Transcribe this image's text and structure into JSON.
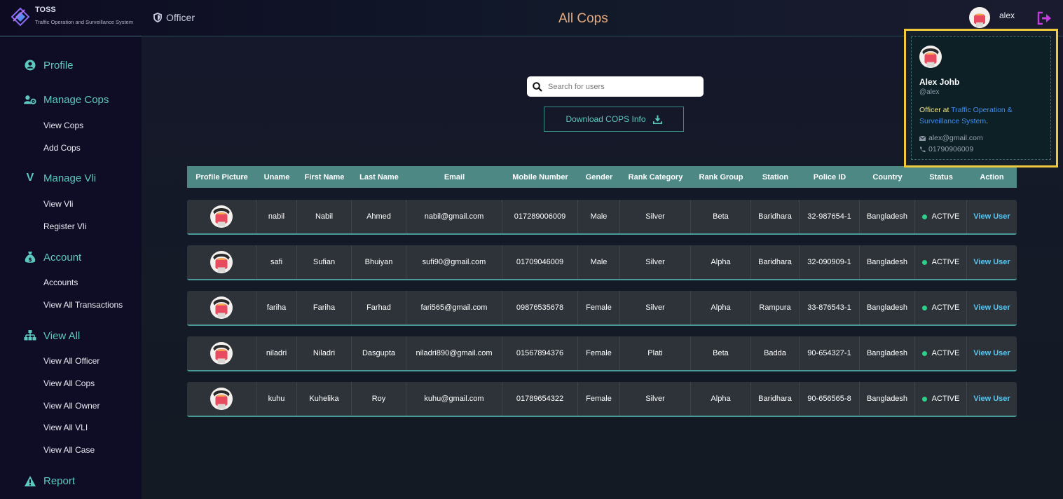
{
  "brand": {
    "title": "TOSS",
    "subtitle": "Traffic Operation and Surveillance System"
  },
  "header": {
    "role": "Officer",
    "page_title": "All Cops",
    "username": "alex"
  },
  "sidebar": {
    "sections": [
      {
        "label": "Profile",
        "icon": "user-circle-icon"
      },
      {
        "label": "Manage Cops",
        "icon": "users-cog-icon",
        "items": [
          "View Cops",
          "Add Cops"
        ]
      },
      {
        "label": "Manage Vli",
        "icon": "v-icon",
        "items": [
          "View Vli",
          "Register Vli"
        ]
      },
      {
        "label": "Account",
        "icon": "money-bag-icon",
        "items": [
          "Accounts",
          "View All Transactions"
        ]
      },
      {
        "label": "View All",
        "icon": "sitemap-icon",
        "items": [
          "View All Officer",
          "View All Cops",
          "View All Owner",
          "View All VLI",
          "View All Case"
        ]
      },
      {
        "label": "Report",
        "icon": "warning-icon"
      }
    ]
  },
  "search": {
    "placeholder": "Search for users"
  },
  "download": {
    "label": "Download COPS Info"
  },
  "table": {
    "headers": [
      "Profile Picture",
      "Uname",
      "First Name",
      "Last Name",
      "Email",
      "Mobile Number",
      "Gender",
      "Rank Category",
      "Rank Group",
      "Station",
      "Police ID",
      "Country",
      "Status",
      "Action"
    ],
    "rows": [
      [
        "nabil",
        "Nabil",
        "Ahmed",
        "nabil@gmail.com",
        "017289006009",
        "Male",
        "Silver",
        "Beta",
        "Baridhara",
        "32-987654-1",
        "Bangladesh",
        "ACTIVE",
        "View User"
      ],
      [
        "safi",
        "Sufian",
        "Bhuiyan",
        "sufi90@gmail.com",
        "01709046009",
        "Male",
        "Silver",
        "Alpha",
        "Baridhara",
        "32-090909-1",
        "Bangladesh",
        "ACTIVE",
        "View User"
      ],
      [
        "fariha",
        "Fariha",
        "Farhad",
        "fari565@gmail.com",
        "09876535678",
        "Female",
        "Silver",
        "Alpha",
        "Rampura",
        "33-876543-1",
        "Bangladesh",
        "ACTIVE",
        "View User"
      ],
      [
        "niladri",
        "Niladri",
        "Dasgupta",
        "niladri890@gmail.com",
        "01567894376",
        "Female",
        "Plati",
        "Beta",
        "Badda",
        "90-654327-1",
        "Bangladesh",
        "ACTIVE",
        "View User"
      ],
      [
        "kuhu",
        "Kuhelika",
        "Roy",
        "kuhu@gmail.com",
        "01789654322",
        "Female",
        "Silver",
        "Alpha",
        "Baridhara",
        "90-656565-8",
        "Bangladesh",
        "ACTIVE",
        "View User"
      ]
    ]
  },
  "profile_popup": {
    "name": "Alex Johb",
    "handle": "@alex",
    "org_prefix": "Officer at ",
    "org_name": "Traffic Operation & Surveillance System",
    "org_suffix": ".",
    "email": "alex@gmail.com",
    "phone": "01790906009"
  },
  "colors": {
    "accent": "#5cc8c0",
    "header_row": "#4d8885",
    "status_active": "#2ecf8a",
    "link": "#58c6f0",
    "title": "#e8a97a",
    "highlight": "#f0c83c"
  }
}
